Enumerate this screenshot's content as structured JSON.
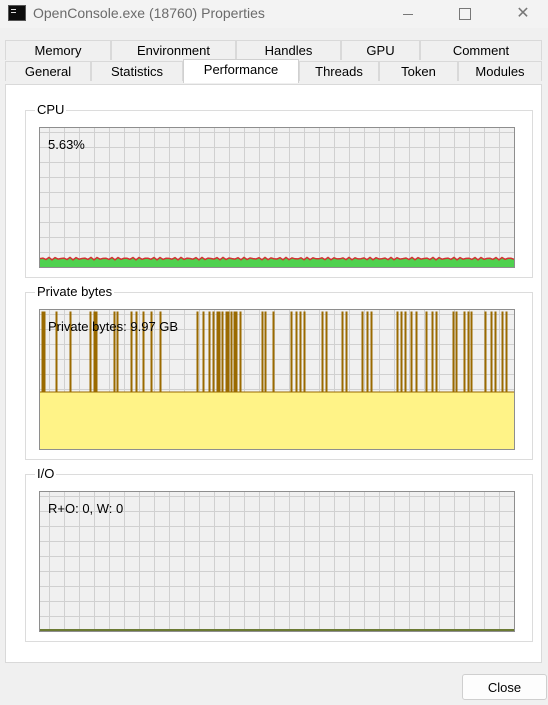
{
  "window": {
    "title": "OpenConsole.exe (18760) Properties"
  },
  "tabs": {
    "row_back": [
      {
        "label": "Memory"
      },
      {
        "label": "Environment"
      },
      {
        "label": "Handles"
      },
      {
        "label": "GPU"
      },
      {
        "label": "Comment"
      }
    ],
    "row_front": [
      {
        "label": "General"
      },
      {
        "label": "Statistics"
      },
      {
        "label": "Performance",
        "selected": true
      },
      {
        "label": "Threads"
      },
      {
        "label": "Token"
      },
      {
        "label": "Modules"
      }
    ]
  },
  "cpu": {
    "group_label": "CPU",
    "value_label": "5.63%",
    "usage_percent": 5.63,
    "colors": {
      "total": "#4fd14f",
      "kernel": "#d23232"
    }
  },
  "private_bytes": {
    "group_label": "Private bytes",
    "value_label": "Private bytes: 9.97 GB",
    "colors": {
      "fill": "#fff387",
      "line": "#9a6a00"
    }
  },
  "io": {
    "group_label": "I/O",
    "value_label": "R+O: 0, W: 0",
    "colors": {
      "line": "#6b7a33"
    }
  },
  "colors": {
    "grid": "#d0d0d0",
    "graph_background": "#f0f0f0",
    "graph_border": "#8e8e8e"
  },
  "buttons": {
    "close_label": "Close"
  }
}
